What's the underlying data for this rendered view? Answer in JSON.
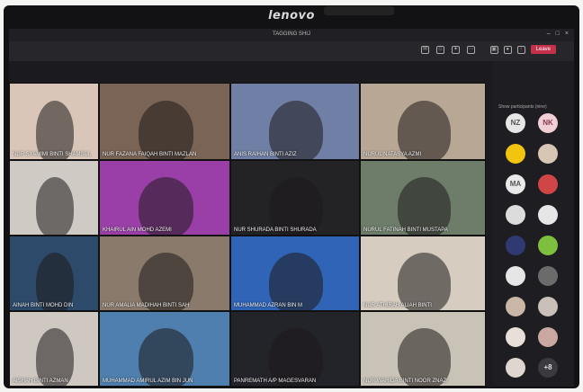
{
  "brand": "lenovo",
  "window": {
    "title": "TAGGING SHIJ",
    "buttons": [
      "–",
      "□",
      "×"
    ]
  },
  "toolbar": {
    "icons": [
      "chat-icon",
      "people-icon",
      "reactions-icon",
      "more-icon"
    ],
    "leave_label": "Leave"
  },
  "participants_panel": {
    "title": "Show participants (nine)"
  },
  "grid": {
    "tiles": [
      {
        "label": "NUR SYAMIMI BINTI SHAMSUL",
        "bg": "#d9c6b8"
      },
      {
        "label": "NUR FAZANA FAIQAH BINTI MAZLAN",
        "bg": "#7a6455"
      },
      {
        "label": "ANIS RAIHAN BINTI AZIZ",
        "bg": "#6f7fa6"
      },
      {
        "label": "NURUL NATASYA AZMI",
        "bg": "#b9a796"
      },
      {
        "label": "",
        "bg": "#cfcac4"
      },
      {
        "label": "KHAIRUL AIN MOHD AZEMI",
        "bg": "#9b3fa8"
      },
      {
        "label": "NUR SHURADA BINTI SHURADA",
        "bg": "#232326"
      },
      {
        "label": "NURUL FATINAH BINTI MUSTAPA",
        "bg": "#6d7d6a"
      },
      {
        "label": "AINAH BINTI MOHD DIN",
        "bg": "#2d4a6b"
      },
      {
        "label": "NUR AMALIA MADIHAH BINTI SAH",
        "bg": "#8a7a6b"
      },
      {
        "label": "MUHAMMAD AZRAN BIN M",
        "bg": "#2f64b7"
      },
      {
        "label": "NUR ATHIRAH ALIAH BINTI",
        "bg": "#d6ccc0"
      },
      {
        "label": "AISHAH BINTI AZMAN",
        "bg": "#cfc8c0"
      },
      {
        "label": "MUHAMMAD AMIRUL AZIM BIN JUN",
        "bg": "#4e7fae"
      },
      {
        "label": "PANREMATH A/P MAGESVARAN",
        "bg": "#23232a"
      },
      {
        "label": "NUR WAHIDA BINTI NOOR ZNAZI",
        "bg": "#c9c2b6"
      }
    ]
  },
  "attendees": [
    {
      "initials": "NZ",
      "bg": "#e6e6e6",
      "fg": "#555"
    },
    {
      "initials": "NK",
      "bg": "#f0d0d6",
      "fg": "#8a3b4a"
    },
    {
      "initials": "",
      "bg": "#f1c40f",
      "fg": "#333"
    },
    {
      "initials": "",
      "bg": "#d8c6b5",
      "fg": "#333"
    },
    {
      "initials": "MA",
      "bg": "#e9e9e9",
      "fg": "#555"
    },
    {
      "initials": "",
      "bg": "#d04545",
      "fg": "#fff"
    },
    {
      "initials": "",
      "bg": "#dcdcdc",
      "fg": "#333"
    },
    {
      "initials": "",
      "bg": "#e6e6e6",
      "fg": "#333"
    },
    {
      "initials": "",
      "bg": "#2f3a73",
      "fg": "#fff"
    },
    {
      "initials": "",
      "bg": "#7fbf3f",
      "fg": "#fff"
    },
    {
      "initials": "",
      "bg": "#e6e6e6",
      "fg": "#333"
    },
    {
      "initials": "",
      "bg": "#6b6b6b",
      "fg": "#fff"
    },
    {
      "initials": "",
      "bg": "#c9b6a6",
      "fg": "#333"
    },
    {
      "initials": "",
      "bg": "#c9c0ba",
      "fg": "#333"
    },
    {
      "initials": "",
      "bg": "#e8e0d8",
      "fg": "#333"
    },
    {
      "initials": "",
      "bg": "#c8a8a0",
      "fg": "#333"
    },
    {
      "initials": "",
      "bg": "#e0d6d0",
      "fg": "#333"
    },
    {
      "initials": "+8",
      "bg": "#3a3a3f",
      "fg": "#ddd"
    }
  ]
}
